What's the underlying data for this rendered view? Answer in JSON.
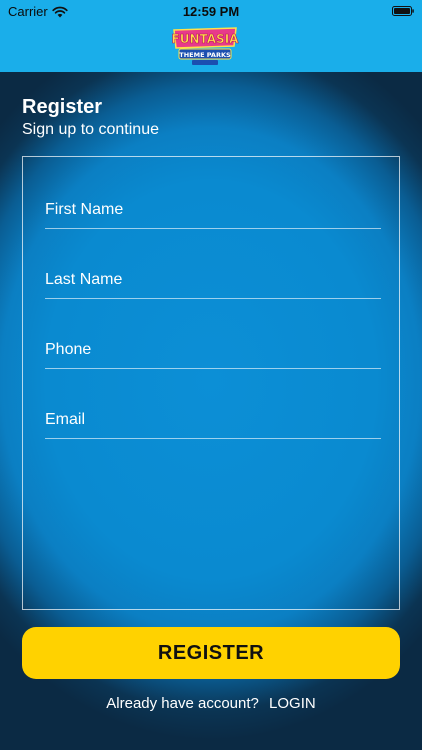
{
  "status_bar": {
    "carrier": "Carrier",
    "time": "12:59 PM"
  },
  "header": {
    "logo_text": "FUNTASIA",
    "logo_subtext": "THEME PARKS"
  },
  "page": {
    "title": "Register",
    "subtitle": "Sign up to continue"
  },
  "form": {
    "first_name": {
      "placeholder": "First Name",
      "value": ""
    },
    "last_name": {
      "placeholder": "Last Name",
      "value": ""
    },
    "phone": {
      "placeholder": "Phone",
      "value": ""
    },
    "email": {
      "placeholder": "Email",
      "value": ""
    }
  },
  "actions": {
    "register_label": "REGISTER",
    "login_prompt": "Already have account?",
    "login_label": "LOGIN"
  },
  "colors": {
    "header_bg": "#1aaeea",
    "glow": "#0c8fd6",
    "background": "#0b2a44",
    "button": "#ffd200"
  }
}
